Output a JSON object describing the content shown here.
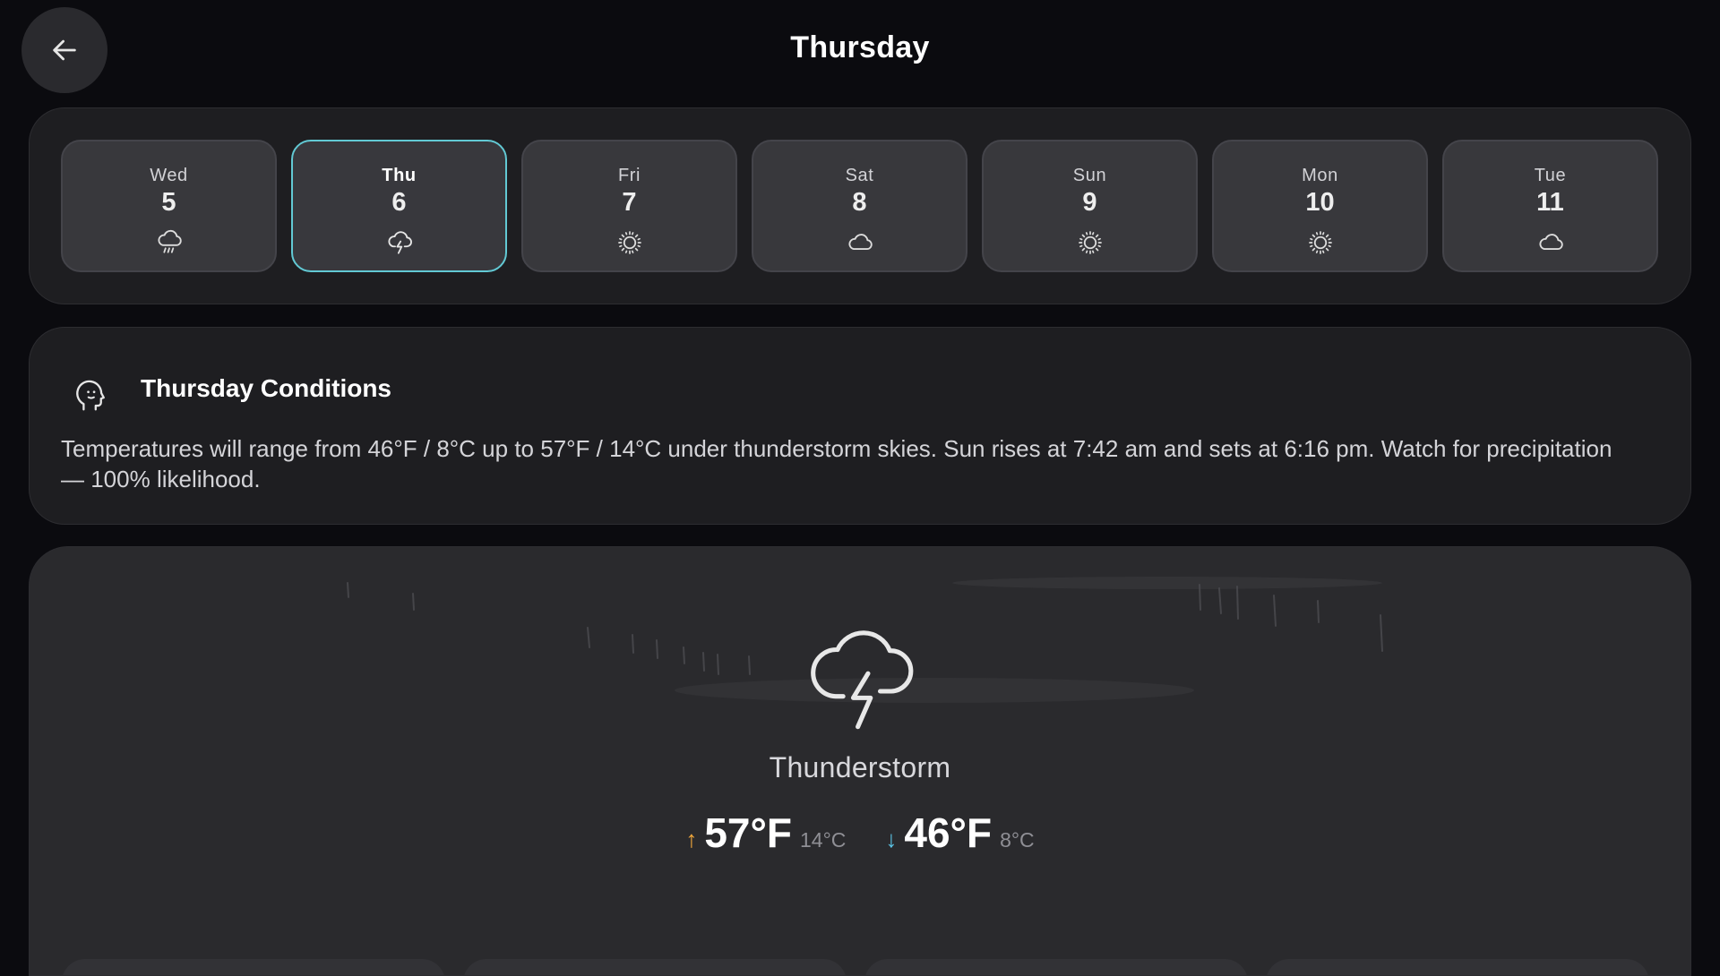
{
  "header": {
    "title": "Thursday",
    "back_icon": "arrow-left-icon"
  },
  "week": {
    "selected_index": 1,
    "accent_color": "#62c9d4",
    "days": [
      {
        "name": "Wed",
        "date": "5",
        "icon": "cloud-rain-icon"
      },
      {
        "name": "Thu",
        "date": "6",
        "icon": "cloud-lightning-icon"
      },
      {
        "name": "Fri",
        "date": "7",
        "icon": "sun-icon"
      },
      {
        "name": "Sat",
        "date": "8",
        "icon": "cloud-icon"
      },
      {
        "name": "Sun",
        "date": "9",
        "icon": "sun-icon"
      },
      {
        "name": "Mon",
        "date": "10",
        "icon": "sun-icon"
      },
      {
        "name": "Tue",
        "date": "11",
        "icon": "cloud-icon"
      }
    ]
  },
  "conditions": {
    "title": "Thursday Conditions",
    "icon": "head-thinking-icon",
    "text": "Temperatures will range from 46°F / 8°C up to 57°F / 14°C under thunderstorm skies. Sun rises at 7:42 am and sets at 6:16 pm. Watch for precipitation — 100% likelihood."
  },
  "hero": {
    "icon": "cloud-lightning-icon",
    "condition": "Thunderstorm",
    "high": {
      "arrow": "↑",
      "f": "57°F",
      "c": "14°C",
      "color": "#f4a93c"
    },
    "low": {
      "arrow": "↓",
      "f": "46°F",
      "c": "8°C",
      "color": "#5bc4e6"
    }
  }
}
